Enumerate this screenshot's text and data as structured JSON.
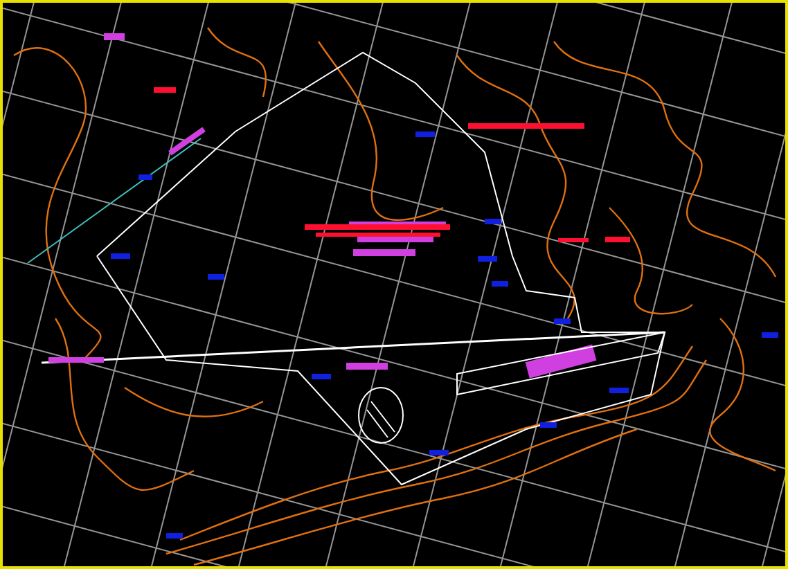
{
  "drawing": {
    "kind": "topographic-plan"
  }
}
